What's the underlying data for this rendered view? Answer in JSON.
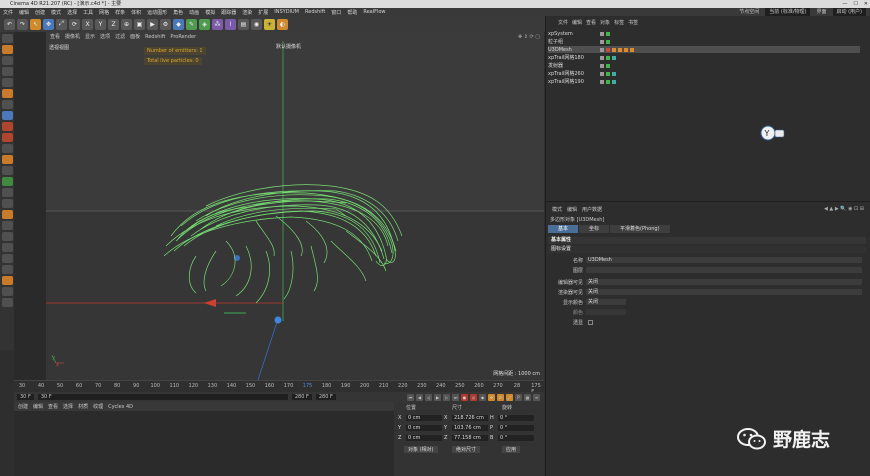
{
  "titlebar": {
    "title": "Cinema 4D R21.207 (RC) - [演示.c4d *] - 主要"
  },
  "menubar": {
    "items": [
      "文件",
      "编辑",
      "创建",
      "模式",
      "选择",
      "工具",
      "网格",
      "样条",
      "体积",
      "运动图形",
      "角色",
      "动画",
      "模拟",
      "跟踪器",
      "渲染",
      "扩展",
      "INSYDIUM",
      "Redshift",
      "窗口",
      "帮助",
      "RealFlow"
    ],
    "node_space_label": "节点空间",
    "node_space_value": "当前 (标准/物理)",
    "layout_label": "界面",
    "layout_value": "启动 (用户)"
  },
  "toolbar": {
    "icons": [
      "undo-icon",
      "redo-icon",
      "live-select-icon",
      "move-icon",
      "scale-icon",
      "rotate-icon",
      "x-axis-icon",
      "y-axis-icon",
      "z-axis-icon",
      "coord-icon",
      "render-view-icon",
      "render-picture-icon",
      "render-settings-icon",
      "cube-icon",
      "pen-icon",
      "subdivide-icon",
      "cloner-icon",
      "deformer-icon",
      "floor-icon",
      "camera-icon",
      "light-icon",
      "redshift-icon"
    ]
  },
  "viewport": {
    "menu": [
      "查看",
      "摄像机",
      "显示",
      "选项",
      "过滤",
      "面板",
      "Redshift",
      "ProRender"
    ],
    "label": "透视视图",
    "camera_label": "默认摄像机",
    "hud_emitters": "Number of emitters: 1",
    "hud_particles": "Total live particles: 0",
    "grid_spacing": "网格间距 : 1000 cm"
  },
  "timeline": {
    "ticks": [
      "30",
      "40",
      "50",
      "60",
      "70",
      "80",
      "90",
      "100",
      "110",
      "120",
      "130",
      "140",
      "150",
      "160",
      "170",
      "175",
      "180",
      "190",
      "200",
      "210",
      "220",
      "230",
      "240",
      "250",
      "260",
      "270",
      "28",
      "175 F"
    ],
    "current_frame": "175",
    "start": "30 F",
    "start2": "30 F",
    "end": "280 F",
    "end2": "280 F"
  },
  "materials": {
    "menu": [
      "创建",
      "编辑",
      "查看",
      "选择",
      "材质",
      "纹理",
      "Cycles 4D"
    ]
  },
  "coords": {
    "headers": [
      "位置",
      "尺寸",
      "旋转"
    ],
    "rows": [
      {
        "axis": "X",
        "pos": "0 cm",
        "size_axis": "X",
        "size": "218.726 cm",
        "rot_axis": "H",
        "rot": "0 °"
      },
      {
        "axis": "Y",
        "pos": "0 cm",
        "size_axis": "Y",
        "size": "103.76 cm",
        "rot_axis": "P",
        "rot": "0 °"
      },
      {
        "axis": "Z",
        "pos": "0 cm",
        "size_axis": "Z",
        "size": "77.158 cm",
        "rot_axis": "B",
        "rot": "0 °"
      }
    ],
    "mode": "对象 (相对)",
    "size_mode": "绝对尺寸",
    "apply": "应用"
  },
  "object_manager": {
    "menu": [
      "文件",
      "编辑",
      "查看",
      "对象",
      "标签",
      "书签"
    ],
    "objects": [
      {
        "name": "xpSystem",
        "tags": [
          "gray",
          "green"
        ],
        "selected": false
      },
      {
        "name": "粒子组",
        "tags": [
          "gray",
          "green"
        ],
        "selected": false
      },
      {
        "name": "U3DMesh",
        "tags": [
          "gray",
          "red",
          "orange",
          "orange",
          "orange",
          "orange"
        ],
        "selected": true
      },
      {
        "name": "xpTrail网格180",
        "tags": [
          "gray",
          "green",
          "teal"
        ],
        "selected": false
      },
      {
        "name": "发射器",
        "tags": [
          "gray",
          "green"
        ],
        "selected": false
      },
      {
        "name": "xpTrail网格260",
        "tags": [
          "gray",
          "green",
          "teal"
        ],
        "selected": false
      },
      {
        "name": "xpTrail网格190",
        "tags": [
          "gray",
          "green",
          "teal"
        ],
        "selected": false
      }
    ]
  },
  "attribute_manager": {
    "menu": [
      "模式",
      "编辑",
      "用户数据"
    ],
    "title": "多边形对象 [U3DMesh]",
    "tabs": [
      "基本",
      "坐标",
      "平滑着色(Phong)"
    ],
    "section": "基本属性",
    "subsection": "图标设置",
    "rows": [
      {
        "label": "名称",
        "value": "U3DMesh"
      },
      {
        "label": "图层",
        "value": ""
      },
      {
        "label": "编辑器可见",
        "value": "关闭"
      },
      {
        "label": "渲染器可见",
        "value": "关闭"
      },
      {
        "label": "显示颜色",
        "value": "关闭"
      },
      {
        "label": "颜色",
        "value": ""
      },
      {
        "label": "透显",
        "value": ""
      }
    ]
  },
  "watermark": {
    "text": "野鹿志"
  },
  "colors": {
    "particles": "#7ef07a",
    "accent_blue": "#4a6f97",
    "hud": "#e0a52b"
  }
}
